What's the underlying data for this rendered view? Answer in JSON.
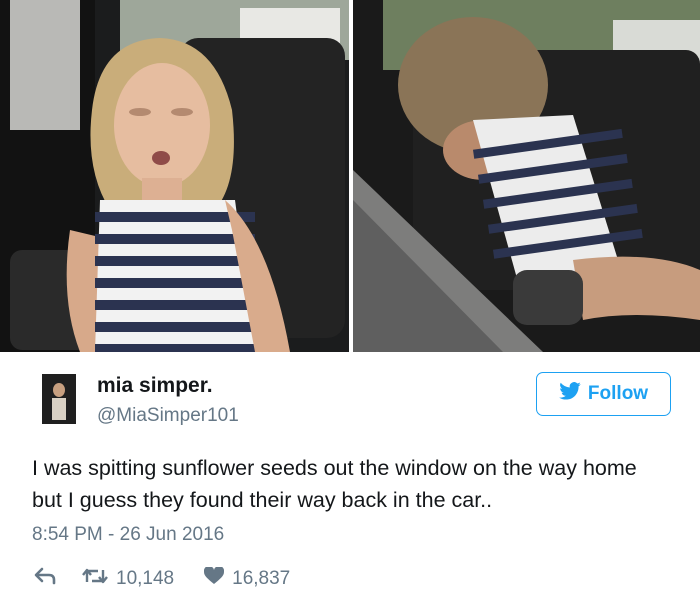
{
  "photos": {
    "left": {
      "description": "photo-left"
    },
    "right": {
      "description": "photo-right"
    }
  },
  "tweet": {
    "display_name": "mia simper.",
    "handle": "@MiaSimper101",
    "follow_label": "Follow",
    "text": "I was spitting sunflower seeds out the window on the way home but I guess they found their way back in the car..",
    "timestamp": "8:54 PM - 26 Jun 2016",
    "retweets": "10,148",
    "likes": "16,837"
  },
  "icons": {
    "follow": "twitter-bird-icon",
    "reply": "reply-icon",
    "retweet": "retweet-icon",
    "like": "heart-icon"
  },
  "colors": {
    "accent": "#1da1f2",
    "muted": "#657786",
    "text": "#14171a"
  }
}
